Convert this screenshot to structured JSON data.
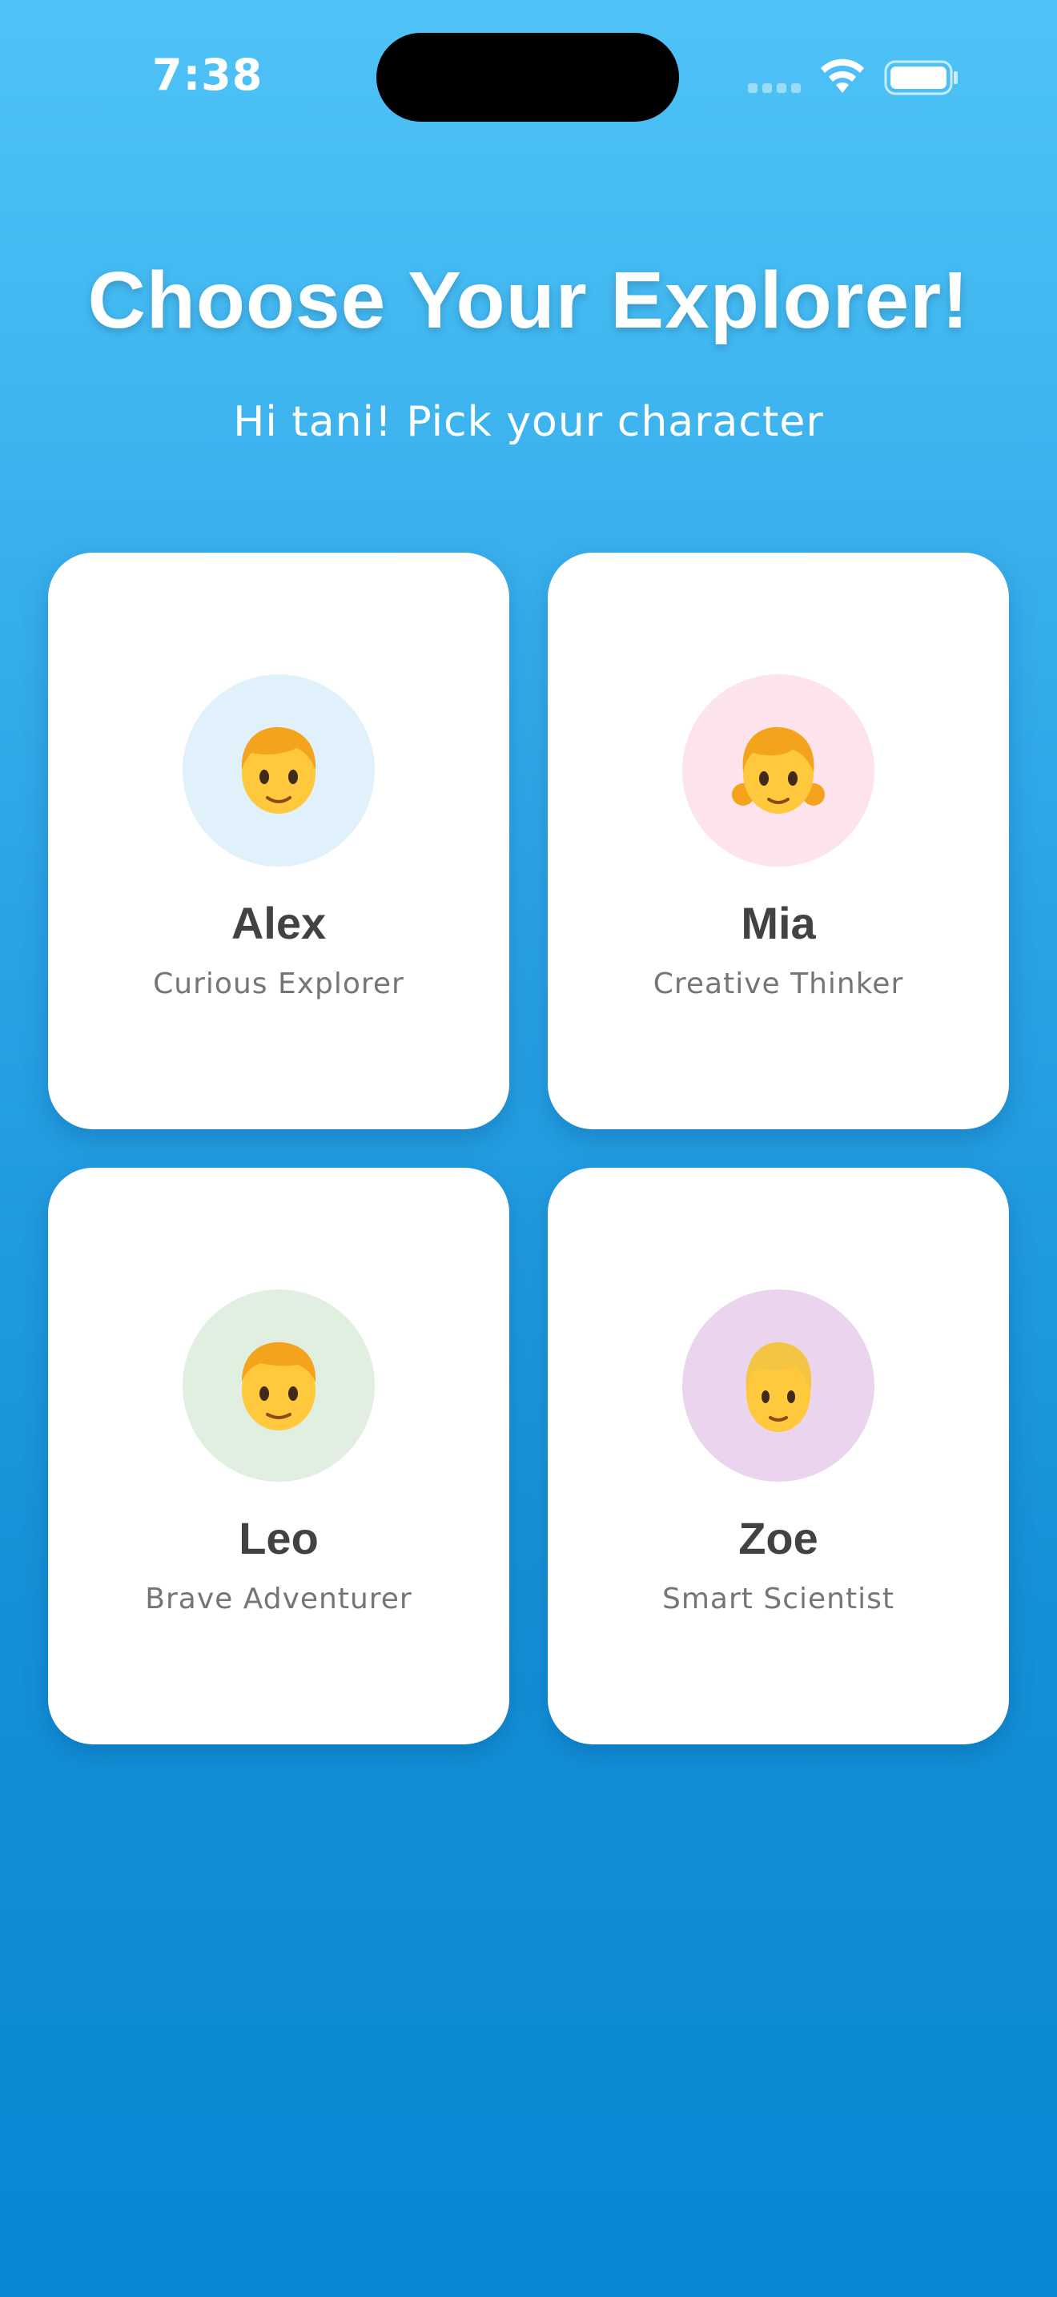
{
  "status_bar": {
    "time": "7:38"
  },
  "header": {
    "title": "Choose Your Explorer!",
    "subtitle": "Hi tani! Pick your character"
  },
  "characters": [
    {
      "name": "Alex",
      "description": "Curious Explorer",
      "avatar_icon": "child-emoji-icon",
      "avatar_bg": "#e0f1fc"
    },
    {
      "name": "Mia",
      "description": "Creative Thinker",
      "avatar_icon": "girl-emoji-icon",
      "avatar_bg": "#fde3ec"
    },
    {
      "name": "Leo",
      "description": "Brave Adventurer",
      "avatar_icon": "boy-emoji-icon",
      "avatar_bg": "#e0efdf"
    },
    {
      "name": "Zoe",
      "description": "Smart Scientist",
      "avatar_icon": "blond-person-emoji-icon",
      "avatar_bg": "#ebd5ee"
    }
  ],
  "colors": {
    "background_top": "#4fc3f7",
    "background_bottom": "#0788d3",
    "card": "#ffffff",
    "name_text": "#424242",
    "description_text": "#757575"
  }
}
